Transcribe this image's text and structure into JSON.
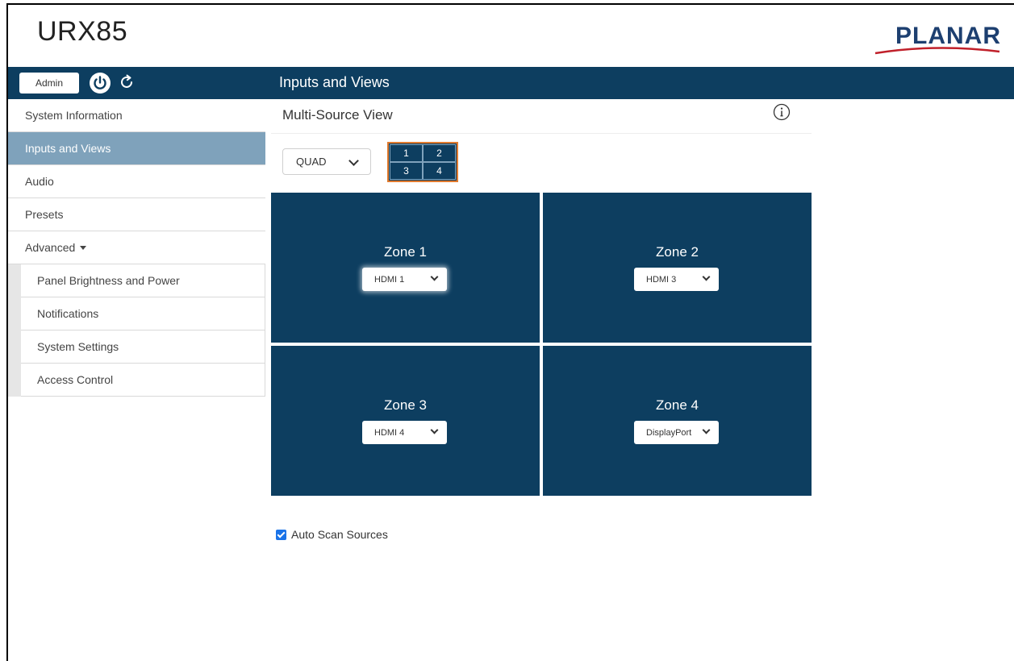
{
  "header": {
    "app_title": "URX85",
    "logo_text": "PLANAR"
  },
  "navbar": {
    "admin_label": "Admin",
    "page_title": "Inputs and Views",
    "icons": [
      "power-icon",
      "refresh-icon"
    ]
  },
  "sidebar": {
    "items": [
      {
        "label": "System Information"
      },
      {
        "label": "Inputs and Views",
        "active": true
      },
      {
        "label": "Audio"
      },
      {
        "label": "Presets"
      },
      {
        "label": "Advanced"
      }
    ],
    "sub_items": [
      {
        "label": "Panel Brightness and Power"
      },
      {
        "label": "Notifications"
      },
      {
        "label": "System Settings"
      },
      {
        "label": "Access Control"
      }
    ]
  },
  "main": {
    "section_title": "Multi-Source View",
    "layout_select": {
      "value": "QUAD"
    },
    "preview_cells": [
      "1",
      "2",
      "3",
      "4"
    ],
    "zones": [
      {
        "label": "Zone 1",
        "source": "HDMI 1"
      },
      {
        "label": "Zone 2",
        "source": "HDMI 3"
      },
      {
        "label": "Zone 3",
        "source": "HDMI 4"
      },
      {
        "label": "Zone 4",
        "source": "DisplayPort"
      }
    ],
    "auto_scan": {
      "label": "Auto Scan Sources",
      "checked": true
    }
  },
  "colors": {
    "navy": "#0d3e60",
    "active_item": "#7fa2bb",
    "preview_border": "#e07a2e",
    "checkbox": "#1a73e8"
  }
}
